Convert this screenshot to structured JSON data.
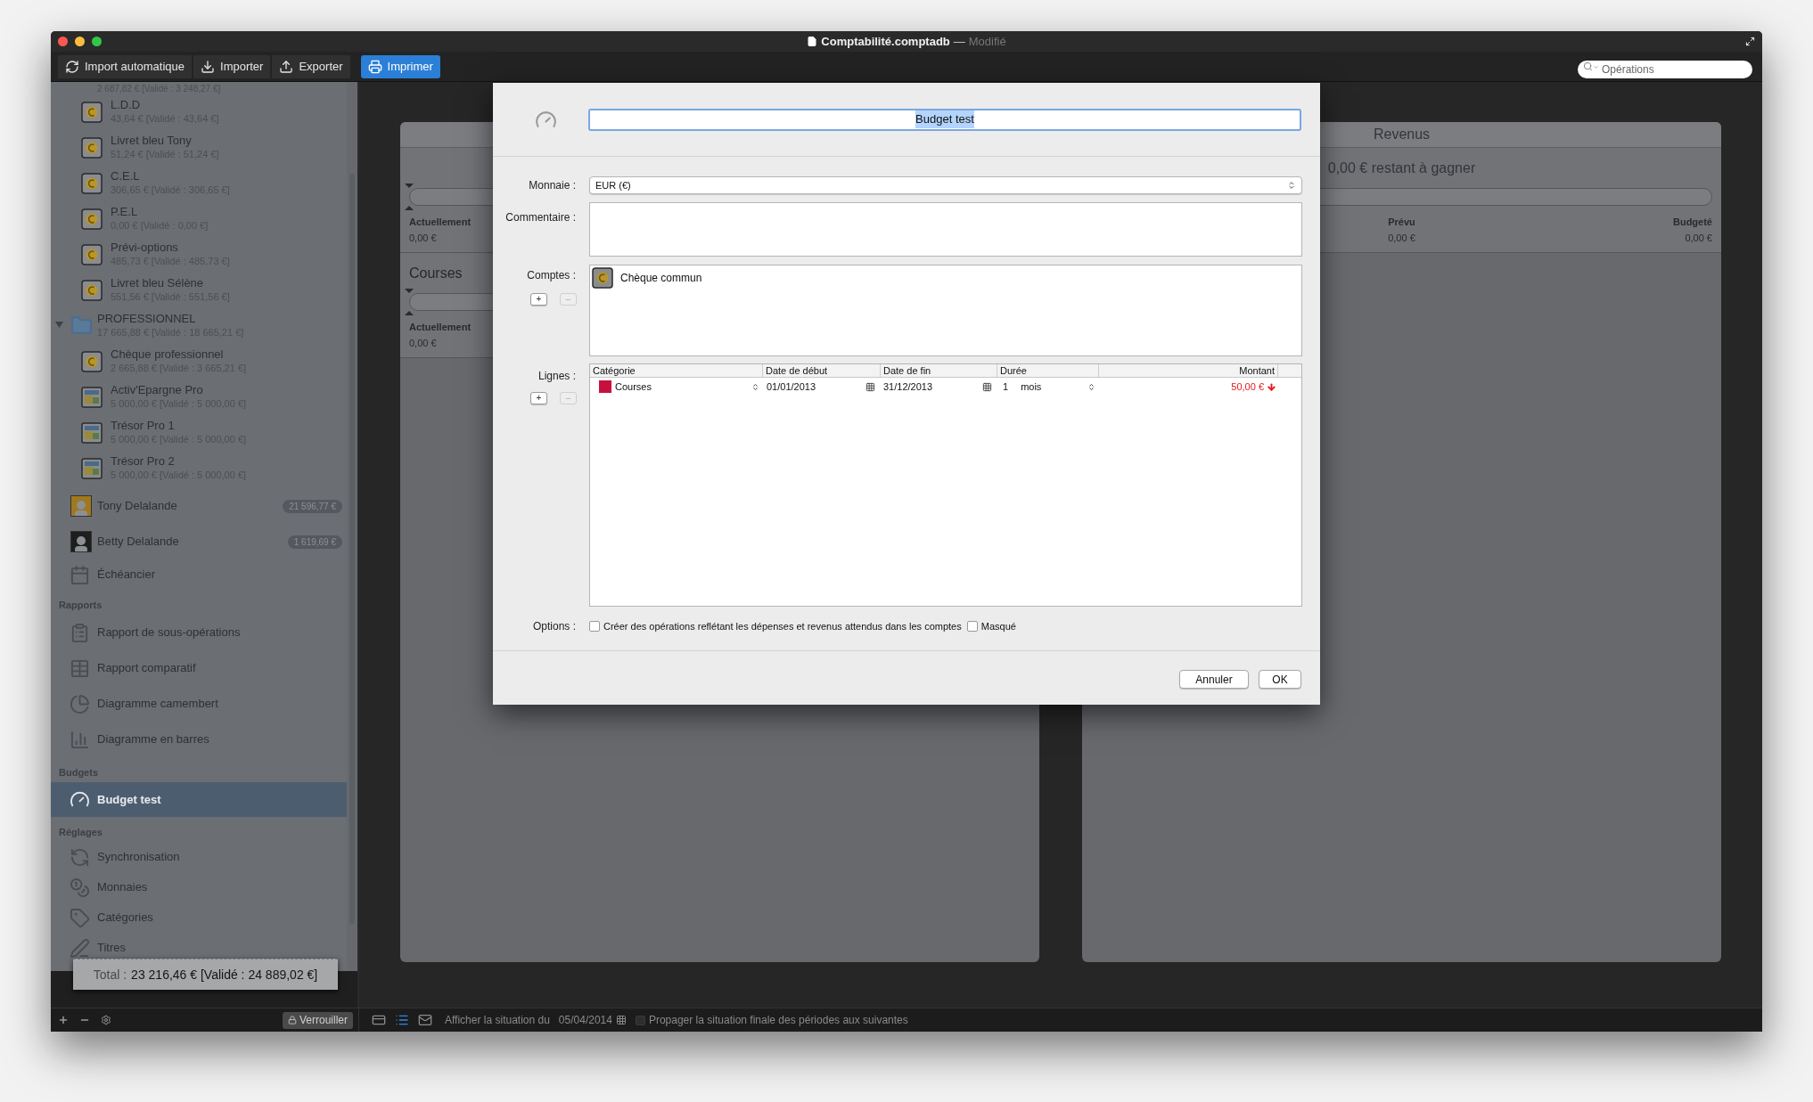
{
  "window": {
    "title": "Comptabilité.comptadb",
    "separator": "—",
    "status": "Modifié"
  },
  "toolbar": {
    "buttons": [
      {
        "label": "Import automatique",
        "kind": "sync",
        "selected": false
      },
      {
        "label": "Importer",
        "kind": "download",
        "selected": false
      },
      {
        "label": "Exporter",
        "kind": "upload",
        "selected": false
      },
      {
        "label": "Imprimer",
        "kind": "print",
        "selected": true
      }
    ],
    "search": {
      "placeholder": "Opérations"
    }
  },
  "sidebar": {
    "clipped_row": "2 687,82 € [Validé : 3 248,27 €]",
    "tree": [
      {
        "kind": "coin",
        "name": "L.D.D",
        "balance": "43,64 € [Validé : 43,64 €]",
        "selected": false
      },
      {
        "kind": "coin",
        "name": "Livret bleu Tony",
        "balance": "51,24 € [Validé : 51,24 €]",
        "selected": false
      },
      {
        "kind": "coin",
        "name": "C.E.L",
        "balance": "306,65 € [Validé : 306,65 €]",
        "selected": false
      },
      {
        "kind": "coin",
        "name": "P.E.L",
        "balance": "0,00 € [Validé : 0,00 €]",
        "selected": false
      },
      {
        "kind": "coin",
        "name": "Prévi-options",
        "balance": "485,73 € [Validé : 485,73 €]",
        "selected": false
      },
      {
        "kind": "coin",
        "name": "Livret bleu Sélène",
        "balance": "551,56 € [Validé : 551,56 €]",
        "selected": false
      },
      {
        "kind": "folder",
        "name": "PROFESSIONNEL",
        "balance": "17 665,88 € [Validé : 18 665,21 €]",
        "expanded": true,
        "selected": false,
        "children": [
          {
            "kind": "coin",
            "name": "Chèque professionnel",
            "balance": "2 665,88 € [Validé : 3 665,21 €]",
            "selected": false
          },
          {
            "kind": "frame",
            "name": "Activ'Epargne Pro",
            "balance": "5 000,00 € [Validé : 5 000,00 €]",
            "selected": false
          },
          {
            "kind": "frame",
            "name": "Trésor Pro 1",
            "balance": "5 000,00 € [Validé : 5 000,00 €]",
            "selected": false
          },
          {
            "kind": "frame",
            "name": "Trésor Pro 2",
            "balance": "5 000,00 € [Validé : 5 000,00 €]",
            "selected": false
          }
        ]
      }
    ],
    "people": [
      {
        "name": "Tony Delalande",
        "badge": "21 596,77 €",
        "selected": false
      },
      {
        "name": "Betty Delalande",
        "badge": "1 619,69 €",
        "selected": false
      }
    ],
    "links": [
      {
        "label": "Échéancier",
        "kind": "calendar",
        "selected": false
      }
    ],
    "sections": [
      {
        "title": "Rapports",
        "items": [
          {
            "label": "Rapport de sous-opérations",
            "kind": "report",
            "selected": false
          },
          {
            "label": "Rapport comparatif",
            "kind": "compare",
            "selected": false
          },
          {
            "label": "Diagramme camembert",
            "kind": "pie",
            "selected": false
          },
          {
            "label": "Diagramme en barres",
            "kind": "bars",
            "selected": false
          }
        ]
      },
      {
        "title": "Budgets",
        "items": [
          {
            "label": "Budget test",
            "kind": "gauge",
            "selected": true
          }
        ]
      },
      {
        "title": "Réglages",
        "items": [
          {
            "label": "Synchronisation",
            "kind": "sync",
            "selected": false
          },
          {
            "label": "Monnaies",
            "kind": "coins",
            "selected": false
          },
          {
            "label": "Catégories",
            "kind": "tag",
            "selected": false
          },
          {
            "label": "Titres",
            "kind": "pen",
            "selected": false
          }
        ]
      }
    ],
    "total": {
      "label": "Total :",
      "value": "23 216,46 € [Validé : 24 889,02 €]"
    },
    "lock_button": "Verrouiller"
  },
  "panels": [
    {
      "sections": [
        {
          "level": 0,
          "stats": [
            {
              "label": "Actuellement",
              "value": "0,00 €"
            }
          ]
        },
        {
          "title": "Courses",
          "level": 0,
          "stats": [
            {
              "label": "Actuellement",
              "value": "0,00 €"
            }
          ]
        }
      ]
    },
    {
      "title": "Revenus",
      "sections": [
        {
          "summary": "0,00 € restant à gagner",
          "stats": [
            {
              "label": "Prévu",
              "value": "0,00 €"
            },
            {
              "label": "Budgeté",
              "value": "0,00 €"
            }
          ]
        }
      ]
    }
  ],
  "dialog": {
    "name": {
      "value": "Budget test",
      "text_selected": true
    },
    "currency": {
      "label": "Monnaie :",
      "value": "EUR (€)"
    },
    "comment": {
      "label": "Commentaire :"
    },
    "accounts": {
      "label": "Comptes :",
      "add": "+",
      "remove": "–",
      "remove_disabled": true,
      "items": [
        {
          "name": "Chèque commun",
          "selected": false
        }
      ]
    },
    "lines": {
      "label": "Lignes :",
      "add": "+",
      "remove": "–",
      "remove_disabled": true,
      "columns": [
        "Catégorie",
        "Date de début",
        "Date de fin",
        "Durée",
        "Montant"
      ],
      "rows": [
        {
          "category": "Courses",
          "color": "#c8103e",
          "start": "01/01/2013",
          "end": "31/12/2013",
          "duration": "1",
          "unit": "mois",
          "amount": "50,00 €",
          "kind": "expense"
        }
      ]
    },
    "options": {
      "label": "Options :",
      "checkboxes": [
        {
          "label": "Créer des opérations reflétant les dépenses et revenus attendus dans les comptes",
          "checked": false
        },
        {
          "label": "Masqué",
          "checked": false
        }
      ]
    },
    "buttons": [
      "Annuler",
      "OK"
    ]
  },
  "status_bar": {
    "views": [
      {
        "kind": "card",
        "selected": false
      },
      {
        "kind": "list",
        "selected": true
      },
      {
        "kind": "mail",
        "selected": false
      }
    ],
    "situation_label": "Afficher la situation du",
    "date": "05/04/2014",
    "propagate": {
      "label": "Propager la situation finale des périodes aux suivantes",
      "checked": false
    }
  }
}
